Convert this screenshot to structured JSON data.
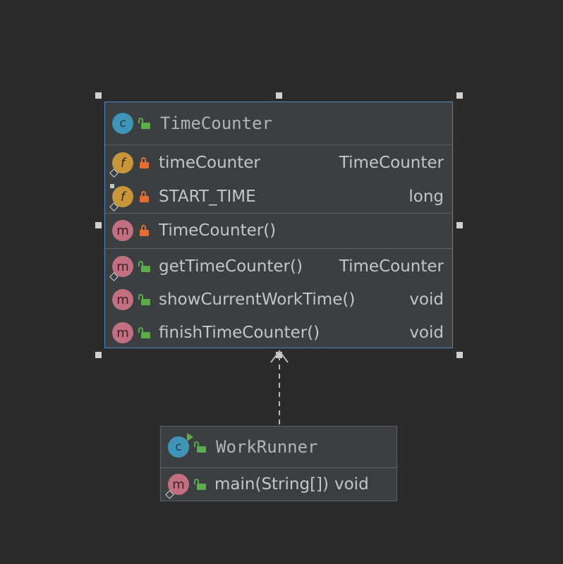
{
  "classes": {
    "time_counter": {
      "name": "TimeCounter",
      "kind_icon": "class-icon",
      "fields": [
        {
          "name": "timeCounter",
          "type": "TimeCounter",
          "icon": "field-icon",
          "visibility": "private",
          "static": false
        },
        {
          "name": "START_TIME",
          "type": "long",
          "icon": "field-icon",
          "visibility": "private",
          "static": true
        }
      ],
      "constructors": [
        {
          "name": "TimeCounter()",
          "type": "",
          "icon": "method-icon",
          "visibility": "private"
        }
      ],
      "methods": [
        {
          "name": "getTimeCounter()",
          "type": "TimeCounter",
          "icon": "method-icon",
          "visibility": "public"
        },
        {
          "name": "showCurrentWorkTime()",
          "type": "void",
          "icon": "method-icon",
          "visibility": "public"
        },
        {
          "name": "finishTimeCounter()",
          "type": "void",
          "icon": "method-icon",
          "visibility": "public"
        }
      ]
    },
    "work_runner": {
      "name": "WorkRunner",
      "kind_icon": "runnable-class-icon",
      "methods": [
        {
          "name": "main(String[])",
          "type": "void",
          "icon": "method-icon",
          "visibility": "public"
        }
      ]
    }
  },
  "icon_glyphs": {
    "class": "c",
    "field": "f",
    "method": "m"
  },
  "relation": {
    "from": "WorkRunner",
    "to": "TimeCounter",
    "style": "dashed-dependency"
  },
  "colors": {
    "background": "#2b2b2b",
    "node_fill": "#3c3f41",
    "selected_border": "#4a88c7",
    "class_icon": "#3e95b8",
    "field_icon": "#c9953b",
    "method_icon": "#c26f81",
    "private_lock": "#e26e33",
    "public_lock": "#5dab4a"
  }
}
